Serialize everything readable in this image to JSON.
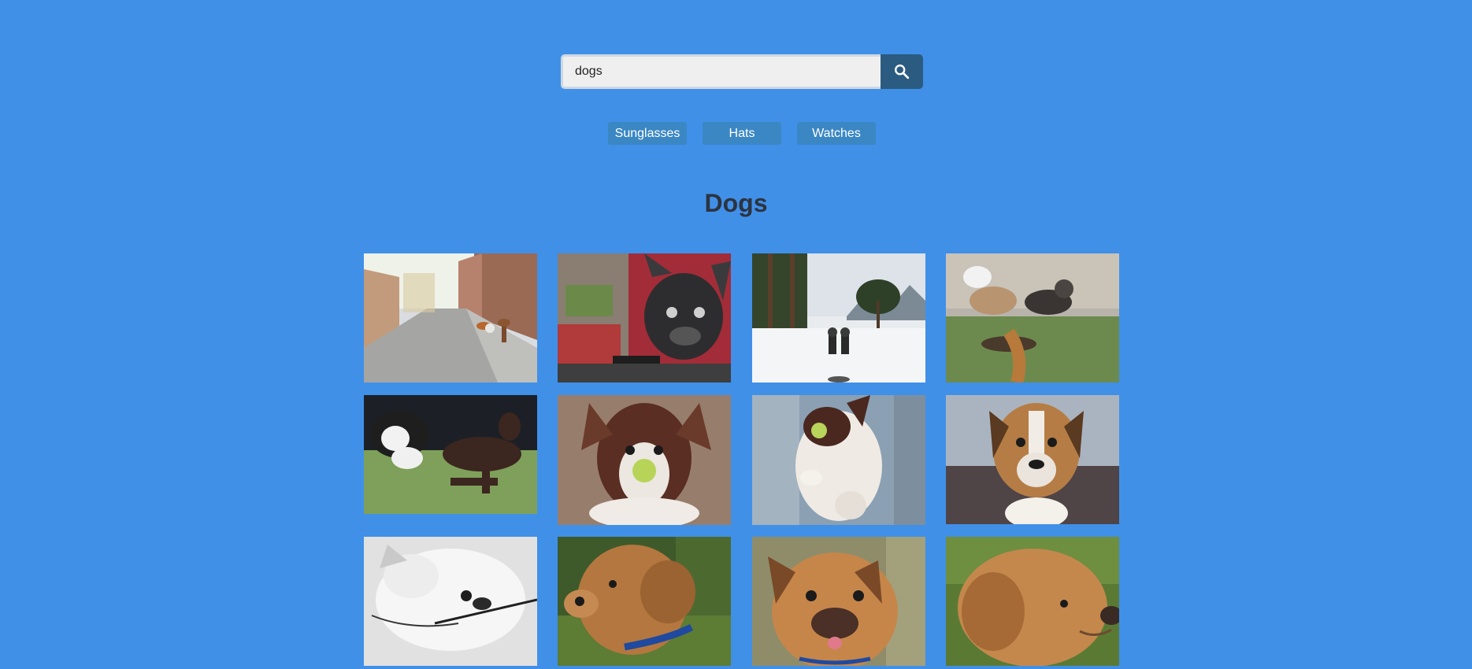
{
  "search": {
    "value": "dogs",
    "button_icon": "search-icon"
  },
  "categories": [
    {
      "label": "Sunglasses"
    },
    {
      "label": "Hats"
    },
    {
      "label": "Watches"
    }
  ],
  "gallery": {
    "title": "Dogs",
    "photos": [
      {
        "icon": "photo-dogs-on-cobblestone-street"
      },
      {
        "icon": "photo-bulldog-graffiti"
      },
      {
        "icon": "photo-sled-dogs-snow"
      },
      {
        "icon": "photo-dogs-playing-dog-park"
      },
      {
        "icon": "photo-dogs-playing-on-grass"
      },
      {
        "icon": "photo-dog-with-tennis-ball"
      },
      {
        "icon": "photo-dog-jumping-tennis-ball"
      },
      {
        "icon": "photo-boxer-mix-portrait"
      },
      {
        "icon": "photo-white-dog-black-and-white"
      },
      {
        "icon": "photo-puppy-blue-collar"
      },
      {
        "icon": "photo-puppy-tongue-out"
      },
      {
        "icon": "photo-puppy-profile"
      }
    ]
  },
  "colors": {
    "background": "#4090e8",
    "search_button": "#2b5b80",
    "category_button": "#3a87c4",
    "title": "#2c3440"
  }
}
